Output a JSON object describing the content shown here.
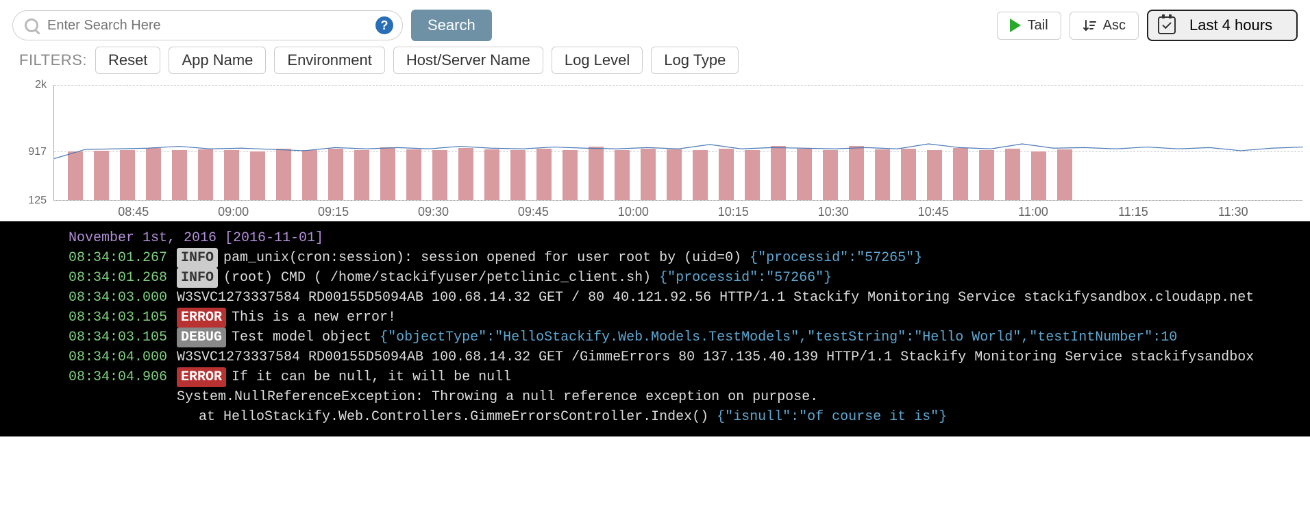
{
  "search": {
    "placeholder": "Enter Search Here",
    "help": "?"
  },
  "buttons": {
    "search": "Search",
    "tail": "Tail",
    "asc": "Asc",
    "timerange": "Last 4 hours"
  },
  "filters": {
    "label": "FILTERS:",
    "reset": "Reset",
    "items": [
      "App Name",
      "Environment",
      "Host/Server Name",
      "Log Level",
      "Log Type"
    ]
  },
  "chart_data": {
    "type": "bar-line-overlay",
    "ylim": [
      125,
      2000
    ],
    "y_ticks": [
      125,
      917,
      2000
    ],
    "x_ticks": [
      "08:45",
      "09:00",
      "09:15",
      "09:30",
      "09:45",
      "10:00",
      "10:15",
      "10:30",
      "10:45",
      "11:00",
      "11:15",
      "11:30"
    ],
    "bar_series": {
      "name": "count",
      "values": [
        920,
        930,
        940,
        970,
        940,
        950,
        935,
        920,
        960,
        940,
        960,
        940,
        980,
        950,
        940,
        970,
        950,
        940,
        960,
        940,
        1000,
        940,
        960,
        950,
        940,
        960,
        940,
        1010,
        960,
        940,
        1010,
        950,
        960,
        940,
        970,
        940,
        960,
        920,
        950
      ]
    },
    "line_series": {
      "name": "trend",
      "values": [
        800,
        950,
        960,
        970,
        1000,
        960,
        970,
        950,
        930,
        980,
        960,
        980,
        960,
        1000,
        970,
        960,
        990,
        970,
        960,
        980,
        960,
        1030,
        960,
        980,
        970,
        960,
        980,
        960,
        1040,
        980,
        960,
        1040,
        970,
        980,
        960,
        990,
        960,
        980,
        930,
        970,
        990
      ]
    }
  },
  "log": {
    "date_header": "November 1st, 2016 [2016-11-01]",
    "entries": [
      {
        "ts": "08:34:01.267",
        "level": "INFO",
        "message": "pam_unix(cron:session): session opened for user root by (uid=0) ",
        "json": "{\"processid\":\"57265\"}"
      },
      {
        "ts": "08:34:01.268",
        "level": "INFO",
        "message": "(root) CMD (   /home/stackifyuser/petclinic_client.sh) ",
        "json": "{\"processid\":\"57266\"}"
      },
      {
        "ts": "08:34:03.000",
        "level": "",
        "message": "W3SVC1273337584 RD00155D5094AB 100.68.14.32 GET / 80 40.121.92.56 HTTP/1.1 Stackify Monitoring Service stackifysandbox.cloudapp.net",
        "json": ""
      },
      {
        "ts": "08:34:03.105",
        "level": "ERROR",
        "message": "This is a new error!",
        "json": ""
      },
      {
        "ts": "08:34:03.105",
        "level": "DEBUG",
        "message": "Test model object ",
        "json": "{\"objectType\":\"HelloStackify.Web.Models.TestModels\",\"testString\":\"Hello World\",\"testIntNumber\":10"
      },
      {
        "ts": "08:34:04.000",
        "level": "",
        "message": "W3SVC1273337584 RD00155D5094AB 100.68.14.32 GET /GimmeErrors 80 137.135.40.139 HTTP/1.1 Stackify Monitoring Service stackifysandbox",
        "json": ""
      },
      {
        "ts": "08:34:04.906",
        "level": "ERROR",
        "message": "If it can be null, it will be null",
        "json": "",
        "continuation": [
          "System.NullReferenceException: Throwing a null reference exception on purpose.",
          "   at HelloStackify.Web.Controllers.GimmeErrorsController.Index() "
        ],
        "cont_json": "{\"isnull\":\"of course it is\"}"
      }
    ]
  }
}
